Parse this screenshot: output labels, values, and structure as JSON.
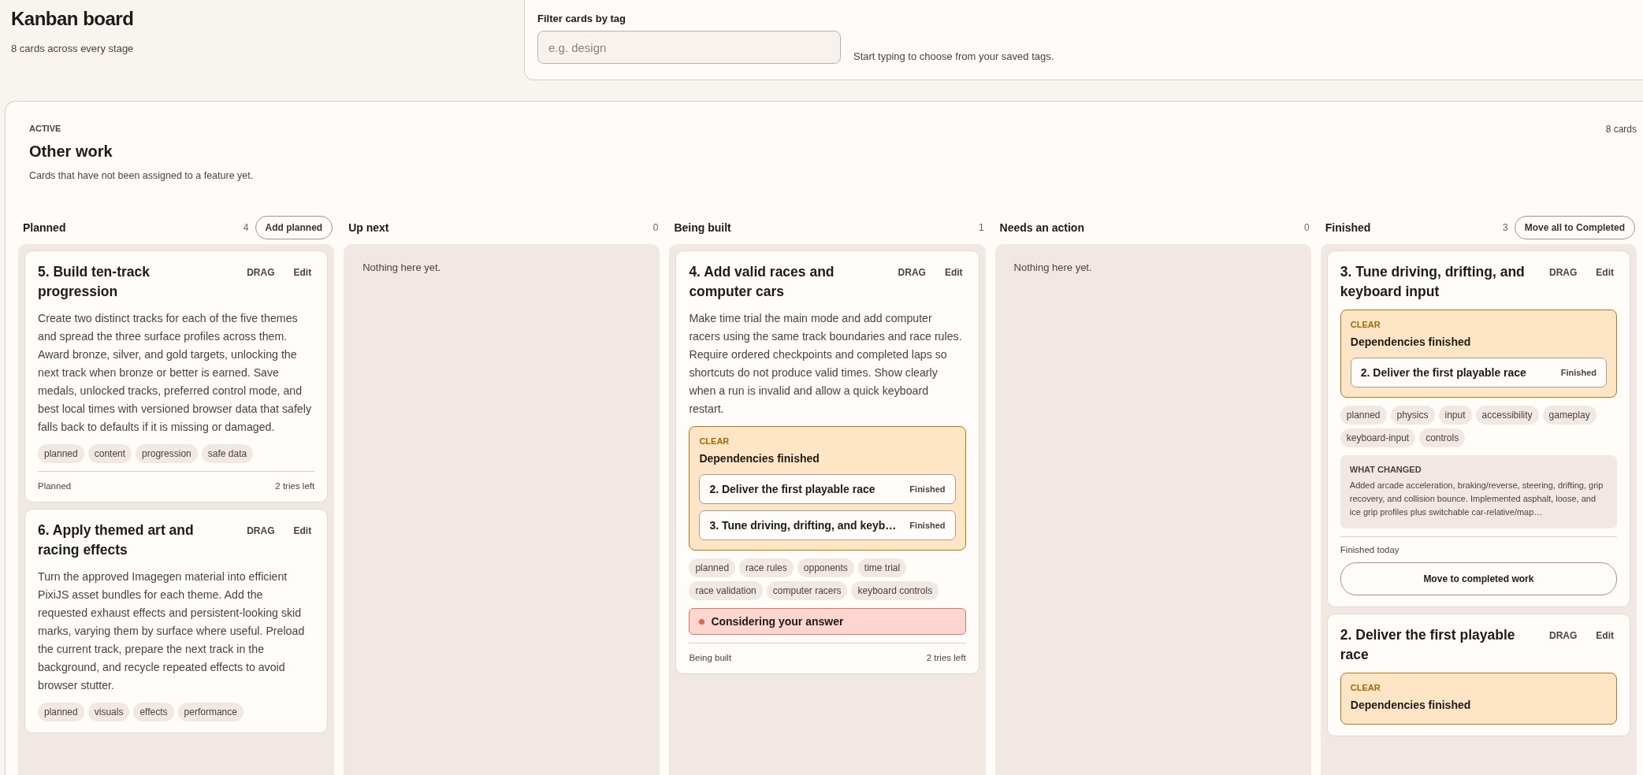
{
  "header": {
    "title": "Kanban board",
    "subtitle": "8 cards across every stage"
  },
  "filter": {
    "label": "Filter cards by tag",
    "placeholder": "e.g. design",
    "hint": "Start typing to choose from your saved tags."
  },
  "section": {
    "eyebrow": "ACTIVE",
    "title": "Other work",
    "description": "Cards that have not been assigned to a feature yet.",
    "count": "8 cards"
  },
  "columns": [
    {
      "title": "Planned",
      "count": "4",
      "action": "Add planned",
      "cards": [
        {
          "title": "5. Build ten-track progression",
          "drag": "DRAG",
          "edit": "Edit",
          "description": "Create two distinct tracks for each of the five themes and spread the three surface profiles across them. Award bronze, silver, and gold targets, unlocking the next track when bronze or better is earned. Save medals, unlocked tracks, preferred control mode, and best local times with versioned browser data that safely falls back to defaults if it is missing or damaged.",
          "tags": [
            "planned",
            "content",
            "progression",
            "safe data"
          ],
          "footer": {
            "stage": "Planned",
            "tries": "2 tries left"
          }
        },
        {
          "title": "6. Apply themed art and racing effects",
          "drag": "DRAG",
          "edit": "Edit",
          "description": "Turn the approved Imagegen material into efficient PixiJS asset bundles for each theme. Add the requested exhaust effects and persistent-looking skid marks, varying them by surface where useful. Preload the current track, prepare the next track in the background, and recycle repeated effects to avoid browser stutter.",
          "tags": [
            "planned",
            "visuals",
            "effects",
            "performance"
          ]
        }
      ]
    },
    {
      "title": "Up next",
      "count": "0",
      "empty_text": "Nothing here yet."
    },
    {
      "title": "Being built",
      "count": "1",
      "cards": [
        {
          "title": "4. Add valid races and computer cars",
          "drag": "DRAG",
          "edit": "Edit",
          "description": "Make time trial the main mode and add computer racers using the same track boundaries and race rules. Require ordered checkpoints and completed laps so shortcuts do not produce valid times. Show clearly when a run is invalid and allow a quick keyboard restart.",
          "dependencies": {
            "status": "CLEAR",
            "title": "Dependencies finished",
            "items": [
              {
                "title": "2. Deliver the first playable race",
                "status": "Finished"
              },
              {
                "title": "3. Tune driving, drifting, and keyb…",
                "status": "Finished"
              }
            ]
          },
          "tags": [
            "planned",
            "race rules",
            "opponents",
            "time trial",
            "race validation",
            "computer racers",
            "keyboard controls"
          ],
          "alert": {
            "text": "Considering your answer"
          },
          "footer": {
            "stage": "Being built",
            "tries": "2 tries left"
          }
        }
      ]
    },
    {
      "title": "Needs an action",
      "count": "0",
      "empty_text": "Nothing here yet."
    },
    {
      "title": "Finished",
      "count": "3",
      "action": "Move all to Completed",
      "cards": [
        {
          "title": "3. Tune driving, drifting, and keyboard input",
          "drag": "DRAG",
          "edit": "Edit",
          "dependencies": {
            "status": "CLEAR",
            "title": "Dependencies finished",
            "items": [
              {
                "title": "2. Deliver the first playable race",
                "status": "Finished"
              }
            ]
          },
          "tags": [
            "planned",
            "physics",
            "input",
            "accessibility",
            "gameplay",
            "keyboard-input",
            "controls"
          ],
          "what_changed": {
            "label": "WHAT CHANGED",
            "text": "Added arcade acceleration, braking/reverse, steering, drifting, grip recovery, and collision bounce. Implemented asphalt, loose, and ice grip profiles plus switchable car-relative/map…"
          },
          "finished_note": "Finished today",
          "action": "Move to completed work"
        },
        {
          "title": "2. Deliver the first playable race",
          "drag": "DRAG",
          "edit": "Edit",
          "dependencies": {
            "status": "CLEAR",
            "title": "Dependencies finished"
          }
        }
      ]
    }
  ]
}
